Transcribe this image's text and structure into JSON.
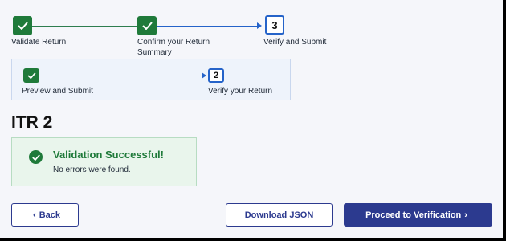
{
  "stepper": {
    "steps": [
      {
        "label_line1": "Validate Return",
        "label_line2": "",
        "status": "done"
      },
      {
        "label_line1": "Confirm your Return",
        "label_line2": "Summary",
        "status": "done"
      },
      {
        "label": "Verify and Submit",
        "number": "3",
        "status": "current"
      }
    ]
  },
  "substeps": {
    "steps": [
      {
        "label": "Preview and Submit",
        "status": "done"
      },
      {
        "label": "Verify your Return",
        "number": "2",
        "status": "current"
      }
    ]
  },
  "page_title": "ITR 2",
  "validation": {
    "title": "Validation Successful!",
    "message": "No errors were found."
  },
  "buttons": {
    "back": "Back",
    "download_json": "Download JSON",
    "proceed": "Proceed to Verification"
  },
  "colors": {
    "success_green": "#1f7a3a",
    "accent_blue": "#2563c9",
    "primary_navy": "#2c3a8f"
  },
  "icons": {
    "check": "check-icon",
    "back": "chevron-left-icon",
    "proceed": "chevron-right-icon",
    "success": "check-circle-icon"
  }
}
